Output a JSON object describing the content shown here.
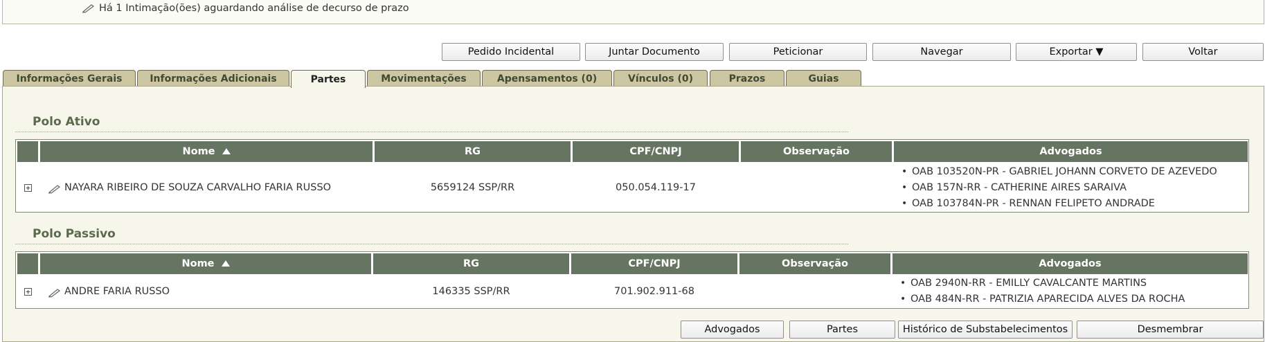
{
  "notice": {
    "text": "Há 1 Intimação(ões) aguardando análise de decurso de prazo",
    "icon": "pencil-icon"
  },
  "actions": [
    {
      "label": "Pedido Incidental"
    },
    {
      "label": "Juntar Documento"
    },
    {
      "label": "Peticionar"
    },
    {
      "label": "Navegar"
    },
    {
      "label": "Exportar ▼"
    },
    {
      "label": "Voltar"
    }
  ],
  "tabs": [
    {
      "label": "Informações Gerais"
    },
    {
      "label": "Informações Adicionais"
    },
    {
      "label": "Partes",
      "active": true
    },
    {
      "label": "Movimentações"
    },
    {
      "label": "Apensamentos (0)"
    },
    {
      "label": "Vínculos (0)"
    },
    {
      "label": "Prazos"
    },
    {
      "label": "Guias"
    }
  ],
  "columns": {
    "nome": "Nome",
    "sort_icon": "sort-ascending-icon",
    "rg": "RG",
    "cpf": "CPF/CNPJ",
    "obs": "Observação",
    "adv": "Advogados"
  },
  "polo_ativo": {
    "title": "Polo Ativo",
    "rows": [
      {
        "nome": "NAYARA RIBEIRO DE SOUZA CARVALHO FARIA RUSSO",
        "rg": "5659124 SSP/RR",
        "cpf": "050.054.119-17",
        "obs": "",
        "advogados": [
          "OAB 103520N-PR - GABRIEL JOHANN CORVETO DE AZEVEDO",
          "OAB 157N-RR - CATHERINE AIRES SARAIVA",
          "OAB 103784N-PR - RENNAN FELIPETO ANDRADE"
        ]
      }
    ]
  },
  "polo_passivo": {
    "title": "Polo Passivo",
    "rows": [
      {
        "nome": "ANDRE FARIA RUSSO",
        "rg": "146335 SSP/RR",
        "cpf": "701.902.911-68",
        "obs": "",
        "advogados": [
          "OAB 2940N-RR - EMILLY CAVALCANTE MARTINS",
          "OAB 484N-RR - PATRIZIA APARECIDA ALVES DA ROCHA"
        ]
      }
    ]
  },
  "bottom_actions": [
    {
      "label": "Advogados"
    },
    {
      "label": "Partes"
    },
    {
      "label": "Histórico de Substabelecimentos"
    },
    {
      "label": "Desmembrar"
    }
  ],
  "colors": {
    "header_bg": "#667561",
    "tab_bg": "#cdc6a2",
    "panel_bg": "#f6f6ea",
    "section_title": "#5a6a4c"
  }
}
